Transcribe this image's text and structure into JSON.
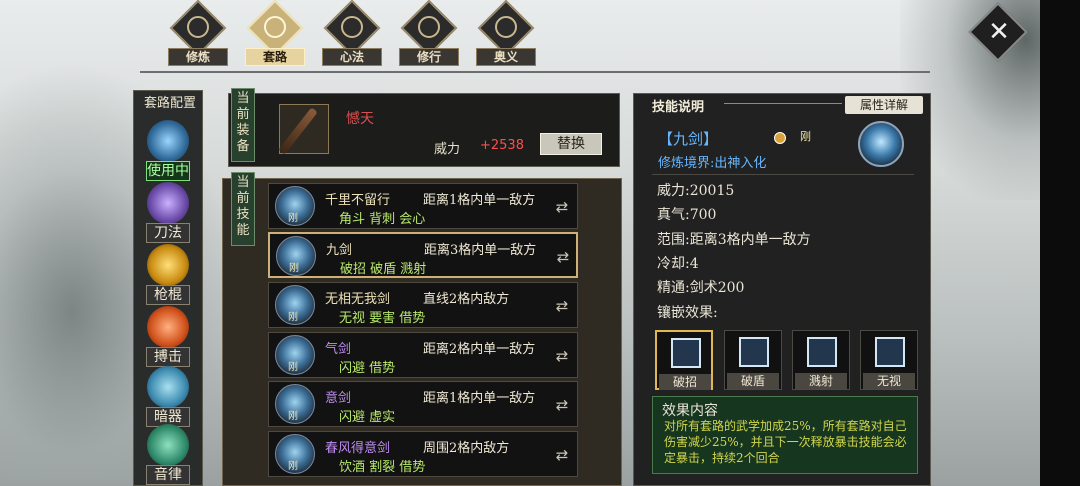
{
  "tabs": [
    {
      "label": "修炼",
      "active": false
    },
    {
      "label": "套路",
      "active": true
    },
    {
      "label": "心法",
      "active": false
    },
    {
      "label": "修行",
      "active": false
    },
    {
      "label": "奥义",
      "active": false
    }
  ],
  "sidebar": {
    "title": "套路配置",
    "categories": [
      {
        "label": "使用中",
        "active": true,
        "color": "#5aa9e0"
      },
      {
        "label": "刀法",
        "active": false,
        "color": "#8a6ad0"
      },
      {
        "label": "枪棍",
        "active": false,
        "color": "#e0a020"
      },
      {
        "label": "搏击",
        "active": false,
        "color": "#e06020"
      },
      {
        "label": "暗器",
        "active": false,
        "color": "#50a0c8"
      },
      {
        "label": "音律",
        "active": false,
        "color": "#3c9a7a"
      }
    ]
  },
  "equipment": {
    "section_label": "当前装备",
    "weapon_name": "憾天",
    "power_label": "威力",
    "power_value": "+2538",
    "replace_label": "替换"
  },
  "skills": {
    "section_label": "当前技能",
    "items": [
      {
        "name": "千里不留行",
        "range": "距离1格内单一敌方",
        "tags": "角斗 背刺 会心",
        "badge": "刚",
        "name_color": "gold",
        "selected": false
      },
      {
        "name": "九剑",
        "range": "距离3格内单一敌方",
        "tags": "破招 破盾 溅射",
        "badge": "刚",
        "name_color": "gold",
        "selected": true
      },
      {
        "name": "无相无我剑",
        "range": "直线2格内敌方",
        "tags": "无视 要害 借势",
        "badge": "刚",
        "name_color": "gold",
        "selected": false
      },
      {
        "name": "气剑",
        "range": "距离2格内单一敌方",
        "tags": "闪避 借势",
        "badge": "刚",
        "name_color": "purple",
        "selected": false
      },
      {
        "name": "意剑",
        "range": "距离1格内单一敌方",
        "tags": "闪避 虚实",
        "badge": "刚",
        "name_color": "purple",
        "selected": false
      },
      {
        "name": "春风得意剑",
        "range": "周围2格内敌方",
        "tags": "饮酒 割裂 借势",
        "badge": "刚",
        "name_color": "purple",
        "selected": false
      }
    ]
  },
  "detail": {
    "title": "技能说明",
    "attr_button": "属性详解",
    "skill_title": "【九剑】",
    "badge": "刚",
    "realm": "修炼境界:出神入化",
    "stats": [
      {
        "label": "威力:",
        "value": "20015"
      },
      {
        "label": "真气:",
        "value": "700"
      },
      {
        "label": "范围:",
        "value": "距离3格内单一敌方"
      },
      {
        "label": "冷却:",
        "value": "4"
      },
      {
        "label": "精通:",
        "value": "剑术200"
      }
    ],
    "inlay_title": "镶嵌效果:",
    "inlays": [
      {
        "label": "破招",
        "icon": "fist-icon",
        "selected": true
      },
      {
        "label": "破盾",
        "icon": "shield-icon",
        "selected": false
      },
      {
        "label": "溅射",
        "icon": "splash-icon",
        "selected": false
      },
      {
        "label": "无视",
        "icon": "eye-icon",
        "selected": false
      }
    ],
    "effect_title": "效果内容",
    "effect_text": "对所有套路的武学加成25%，所有套路对自己伤害减少25%，并且下一次释放暴击技能会必定暴击，持续2个回合"
  }
}
